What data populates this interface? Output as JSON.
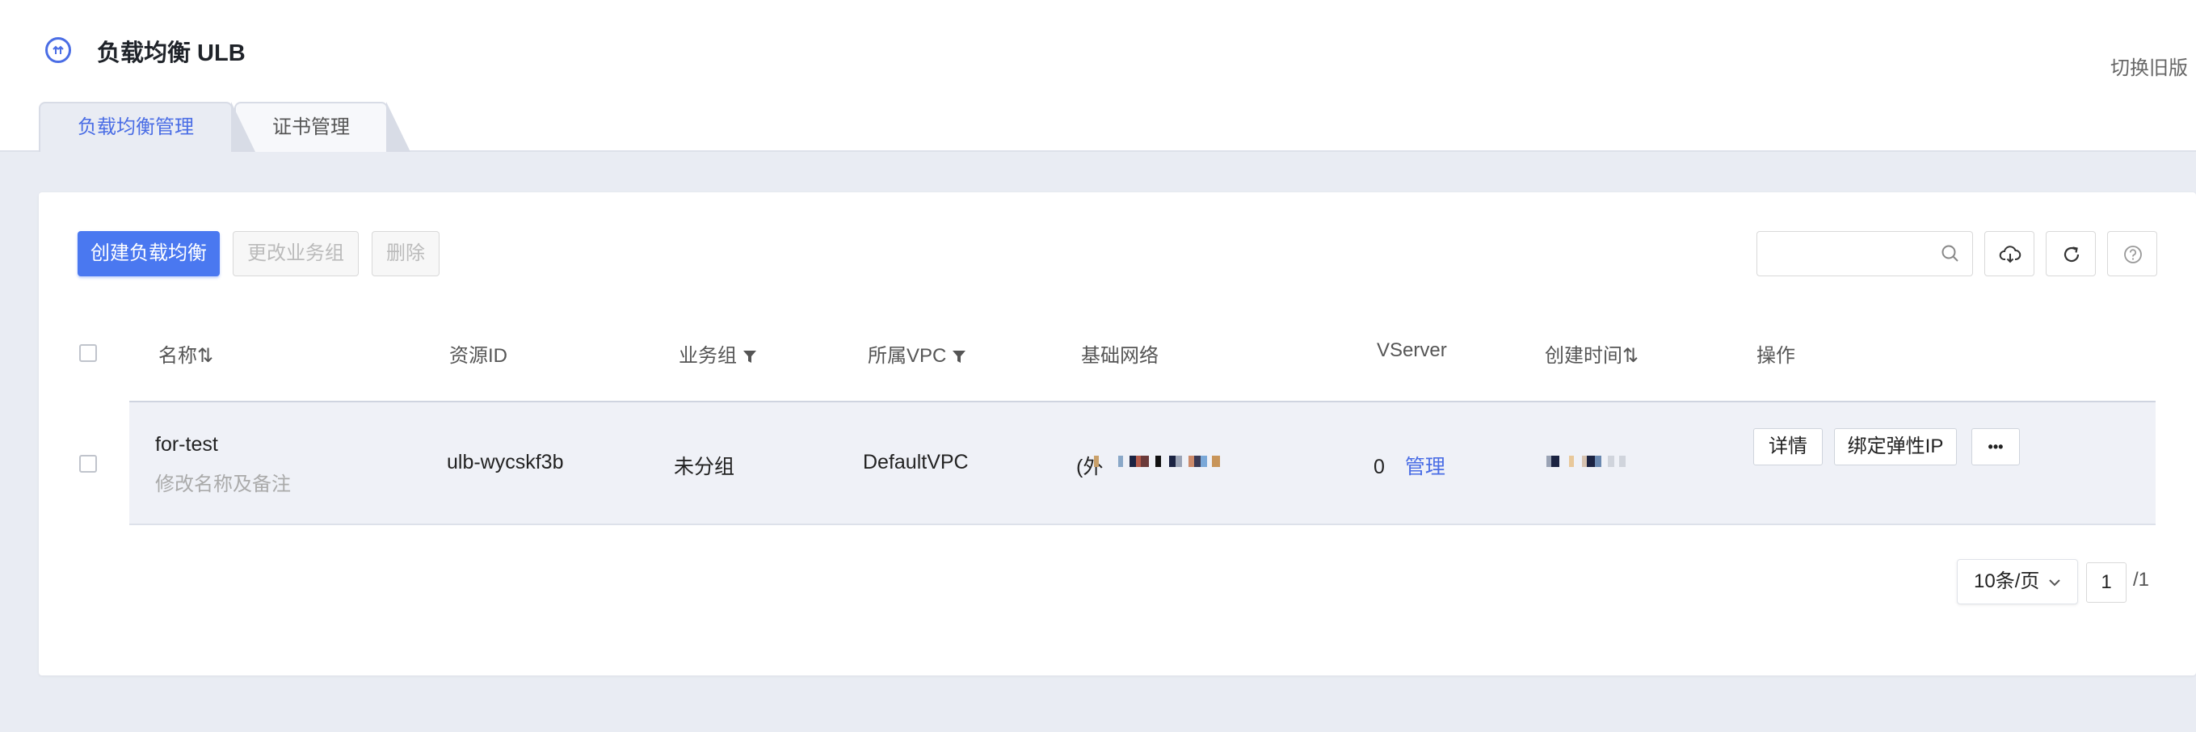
{
  "header": {
    "title": "负载均衡 ULB",
    "switch_link": "切换旧版"
  },
  "tabs": [
    {
      "label": "负载均衡管理",
      "active": true
    },
    {
      "label": "证书管理",
      "active": false
    }
  ],
  "toolbar": {
    "create_label": "创建负载均衡",
    "change_group_label": "更改业务组",
    "delete_label": "删除",
    "search_placeholder": ""
  },
  "table": {
    "columns": [
      "名称⇅",
      "资源ID",
      "业务组",
      "所属VPC",
      "基础网络",
      "VServer",
      "创建时间⇅",
      "操作"
    ],
    "rows": [
      {
        "name": "for-test",
        "remark": "修改名称及备注",
        "resource_id": "ulb-wycskf3b",
        "group": "未分组",
        "vpc": "DefaultVPC",
        "network_prefix": "(外",
        "vserver_count": "0",
        "vserver_manage": "管理",
        "actions": {
          "detail": "详情",
          "bind_eip": "绑定弹性IP",
          "more": "•••"
        }
      }
    ]
  },
  "pagination": {
    "page_size": "10条/页",
    "current_page": "1",
    "total_pages": "/1"
  },
  "colors": {
    "primary": "#4a78f0",
    "accent_link": "#4a6de5",
    "background": "#e9ecf3"
  }
}
